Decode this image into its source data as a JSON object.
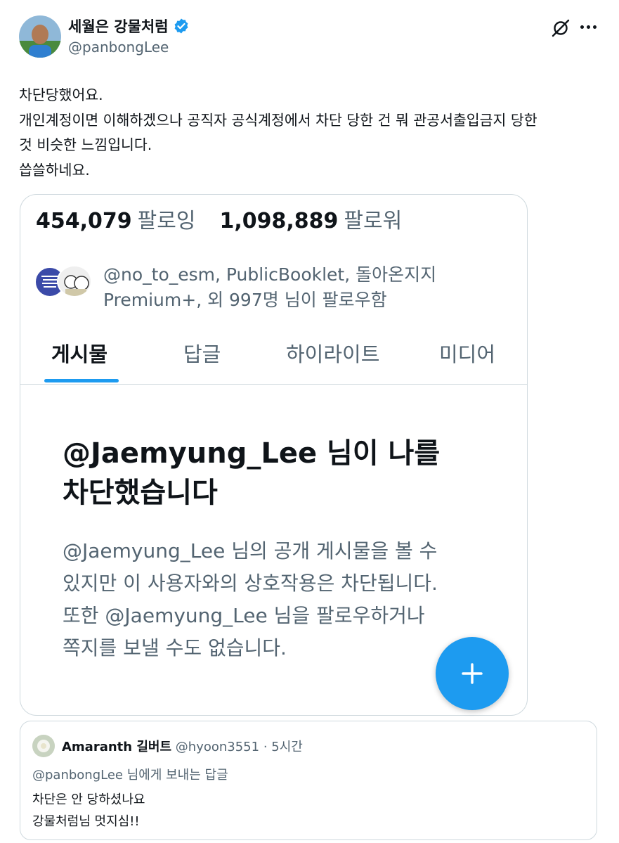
{
  "author": {
    "name": "세월은 강물처럼",
    "handle": "@panbongLee",
    "verified": true
  },
  "icons": {
    "verified": "verified-badge-icon",
    "grok": "grok-icon",
    "more": "more-options-icon",
    "compose": "plus-icon"
  },
  "colors": {
    "accent": "#1d9bf0",
    "text_primary": "#0f1419",
    "text_secondary": "#536471",
    "border": "#cfd9de"
  },
  "tweet": {
    "lines": [
      "차단당했어요.",
      "개인계정이면 이해하겠으나 공직자 공식계정에서 차단 당한 건 뭐 관공서출입금지 당한",
      "것 비슷한 느낌입니다.",
      "씁쓸하네요."
    ]
  },
  "screenshot": {
    "following_count": "454,079",
    "following_label": "팔로잉",
    "followers_count": "1,098,889",
    "followers_label": "팔로워",
    "followed_by_line1": "@no_to_esm, PublicBooklet, 돌아온지지",
    "followed_by_line2": "Premium+, 외 997명 님이 팔로우함",
    "tabs": [
      "게시물",
      "답글",
      "하이라이트",
      "미디어"
    ],
    "active_tab": "게시물",
    "block_title_line1": "@Jaemyung_Lee 님이 나를",
    "block_title_line2": "차단했습니다",
    "block_desc": [
      "@Jaemyung_Lee 님의 공개 게시물을 볼 수",
      "있지만 이 사용자와의 상호작용은 차단됩니다.",
      "또한 @Jaemyung_Lee 님을 팔로우하거나",
      "쪽지를 보낼 수도 없습니다."
    ]
  },
  "quote": {
    "name": "Amaranth 길버트",
    "handle": "@hyoon3551",
    "separator": "·",
    "time": "5시간",
    "reply_to": "@panbongLee 님에게 보내는 답글",
    "lines": [
      "차단은 안 당하셨나요",
      "강물처럼님 멋지심!!"
    ]
  }
}
